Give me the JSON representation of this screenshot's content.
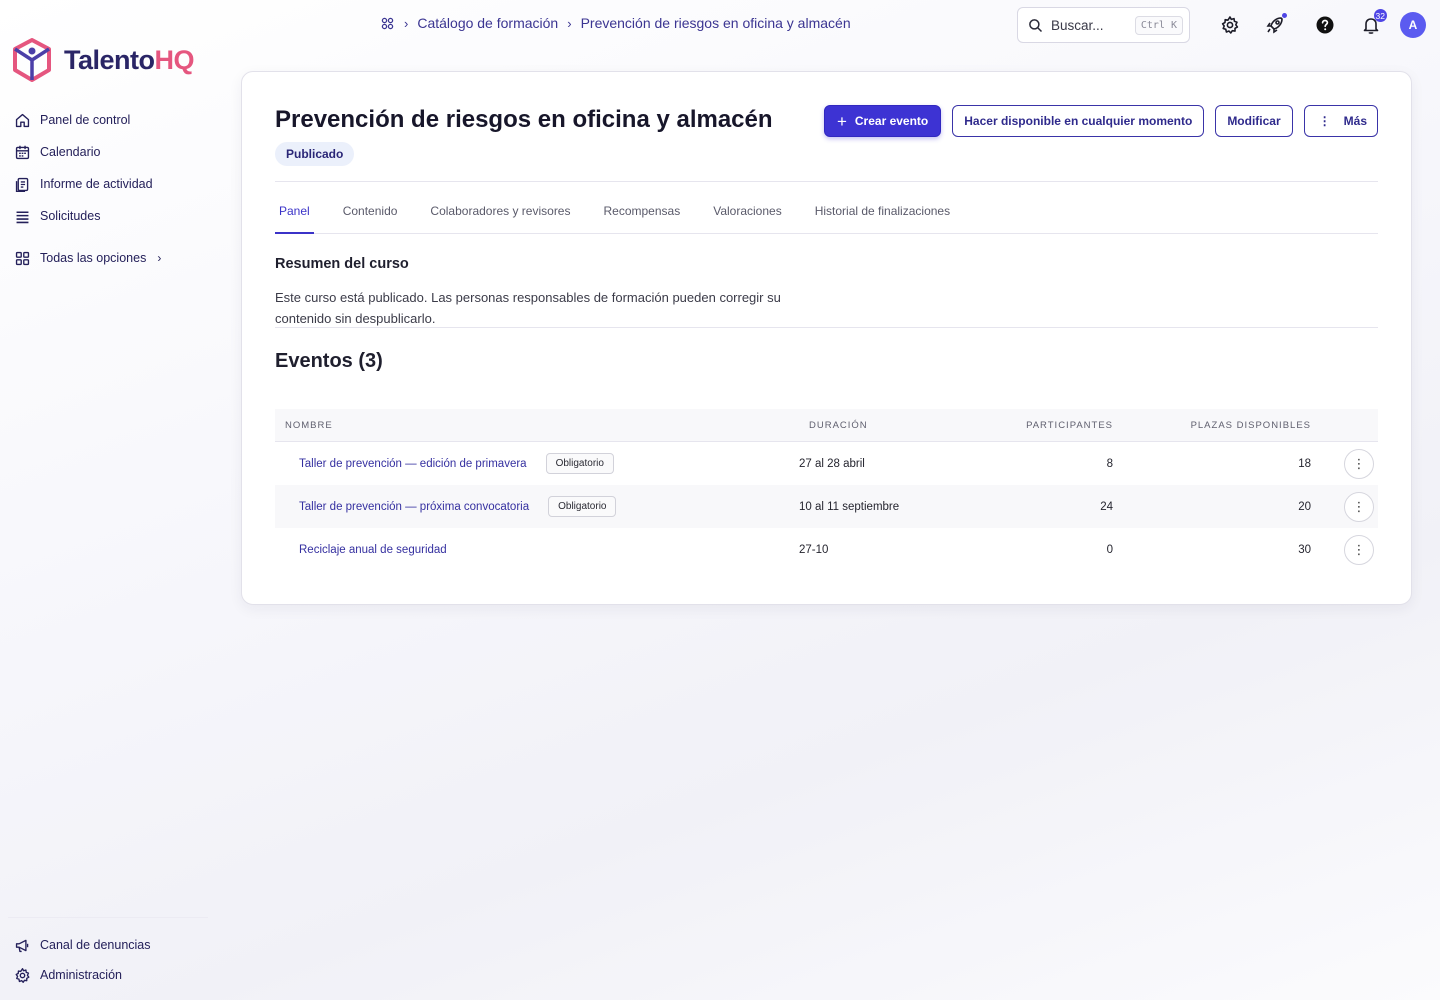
{
  "app": {
    "logo_text_main": "Talento",
    "logo_text_accent": "HQ",
    "brand_color": "#2a2566",
    "accent_color": "#e5567f",
    "primary_color": "#3d33d3"
  },
  "sidebar": {
    "items": [
      {
        "label": "Panel de control",
        "icon": "home-icon"
      },
      {
        "label": "Calendario",
        "icon": "calendar-icon"
      },
      {
        "label": "Informe de actividad",
        "icon": "report-icon"
      },
      {
        "label": "Solicitudes",
        "icon": "list-icon"
      }
    ],
    "all_options_label": "Todas las opciones",
    "bottom_items": [
      {
        "label": "Canal de denuncias",
        "icon": "megaphone-icon"
      },
      {
        "label": "Administración",
        "icon": "gear-icon"
      }
    ]
  },
  "topbar": {
    "breadcrumb": [
      "Catálogo de formación",
      "Prevención de riesgos en oficina y almacén"
    ],
    "search_placeholder": "Buscar...",
    "search_shortcut": "Ctrl K",
    "notifications_count": "32",
    "avatar_initial": "A"
  },
  "course": {
    "title": "Prevención de riesgos en oficina y almacén",
    "status": "Publicado",
    "actions": {
      "create_event": "Crear evento",
      "make_available": "Hacer disponible en cualquier momento",
      "modify": "Modificar",
      "more": "Más"
    },
    "tabs": [
      {
        "label": "Panel",
        "active": true
      },
      {
        "label": "Contenido",
        "active": false
      },
      {
        "label": "Colaboradores y revisores",
        "active": false
      },
      {
        "label": "Recompensas",
        "active": false
      },
      {
        "label": "Valoraciones",
        "active": false
      },
      {
        "label": "Historial de finalizaciones",
        "active": false
      }
    ],
    "summary_title": "Resumen del curso",
    "summary_text": "Este curso está publicado. Las personas responsables de formación pueden corregir su contenido sin despublicarlo.",
    "events_title": "Eventos (3)"
  },
  "events_table": {
    "headers": {
      "name": "NOMBRE",
      "duration": "DURACIÓN",
      "participants": "PARTICIPANTES",
      "spots": "PLAZAS DISPONIBLES"
    },
    "rows": [
      {
        "name": "Taller de prevención — edición de primavera",
        "tag": "Obligatorio",
        "duration": "27 al 28 abril",
        "participants": "8",
        "spots": "18"
      },
      {
        "name": "Taller de prevención — próxima convocatoria",
        "tag": "Obligatorio",
        "duration": "10 al 11 septiembre",
        "participants": "24",
        "spots": "20"
      },
      {
        "name": "Reciclaje anual de seguridad",
        "tag": "",
        "duration": "27-10",
        "participants": "0",
        "spots": "30"
      }
    ]
  }
}
